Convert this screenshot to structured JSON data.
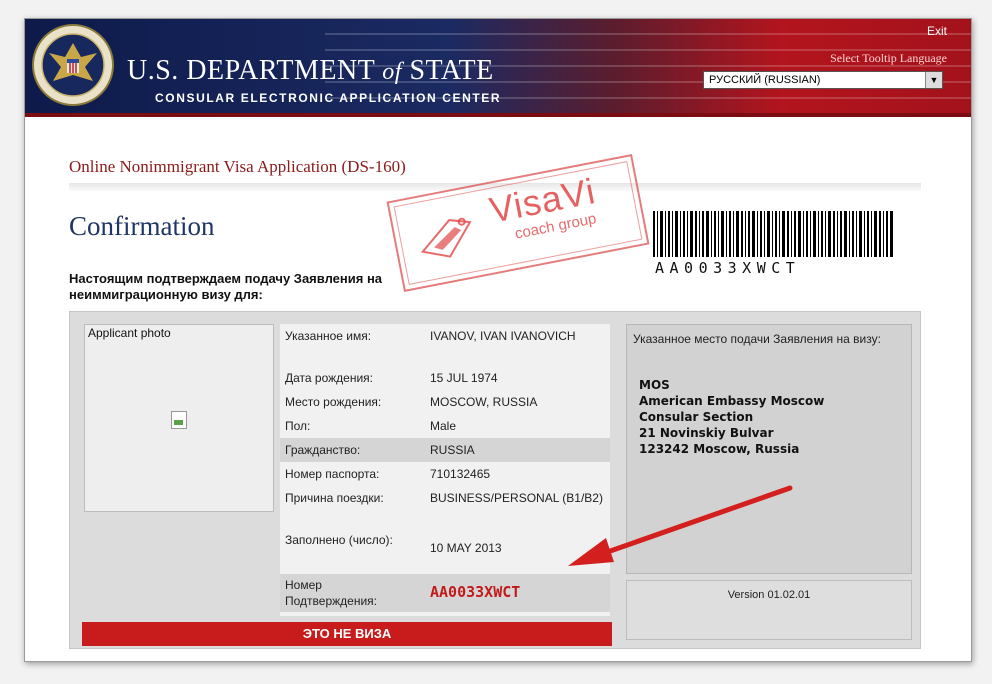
{
  "header": {
    "dept_us": "U.S. ",
    "dept_dept": "DEPARTMENT ",
    "dept_of": "of",
    "dept_state": " STATE",
    "subtitle": "CONSULAR ELECTRONIC APPLICATION CENTER",
    "exit_label": "Exit",
    "tooltip_label": "Select Tooltip Language",
    "language_value": "РУССКИЙ (RUSSIAN)"
  },
  "page": {
    "app_title": "Online Nonimmigrant Visa Application (DS-160)",
    "heading": "Confirmation",
    "intro": "Настоящим подтверждаем подачу Заявления на неиммиграционную визу для:"
  },
  "watermark": {
    "name": "VisaVi",
    "sub": "coach group"
  },
  "barcode": {
    "text": "AA0033XWCT"
  },
  "applicant": {
    "photo_label": "Applicant photo",
    "fields": [
      {
        "key": "Указанное имя:",
        "value": "IVANOV, IVAN IVANOVICH"
      },
      {
        "key": "Дата рождения:",
        "value": "15 JUL 1974"
      },
      {
        "key": "Место рождения:",
        "value": "MOSCOW, RUSSIA"
      },
      {
        "key": "Пол:",
        "value": "Male"
      },
      {
        "key": "Гражданство:",
        "value": "RUSSIA"
      },
      {
        "key": "Номер паспорта:",
        "value": "710132465"
      },
      {
        "key": "Причина поездки:",
        "value": "BUSINESS/PERSONAL (B1/B2)"
      },
      {
        "key": "Заполнено (число):",
        "value": "10 MAY 2013"
      },
      {
        "key": "Номер Подтверждения:",
        "value": "AA0033XWCT"
      }
    ],
    "not_visa": "ЭТО НЕ ВИЗА"
  },
  "location": {
    "heading": "Указанное место подачи Заявления на визу:",
    "lines": [
      "MOS",
      "American Embassy Moscow",
      "Consular Section",
      "21 Novinskiy Bulvar",
      "123242 Moscow, Russia"
    ]
  },
  "version": "Version 01.02.01",
  "colors": {
    "navy": "#1b2a62",
    "red": "#b3141d",
    "confirm_red": "#c21a1a",
    "arrow": "#d3201e"
  }
}
